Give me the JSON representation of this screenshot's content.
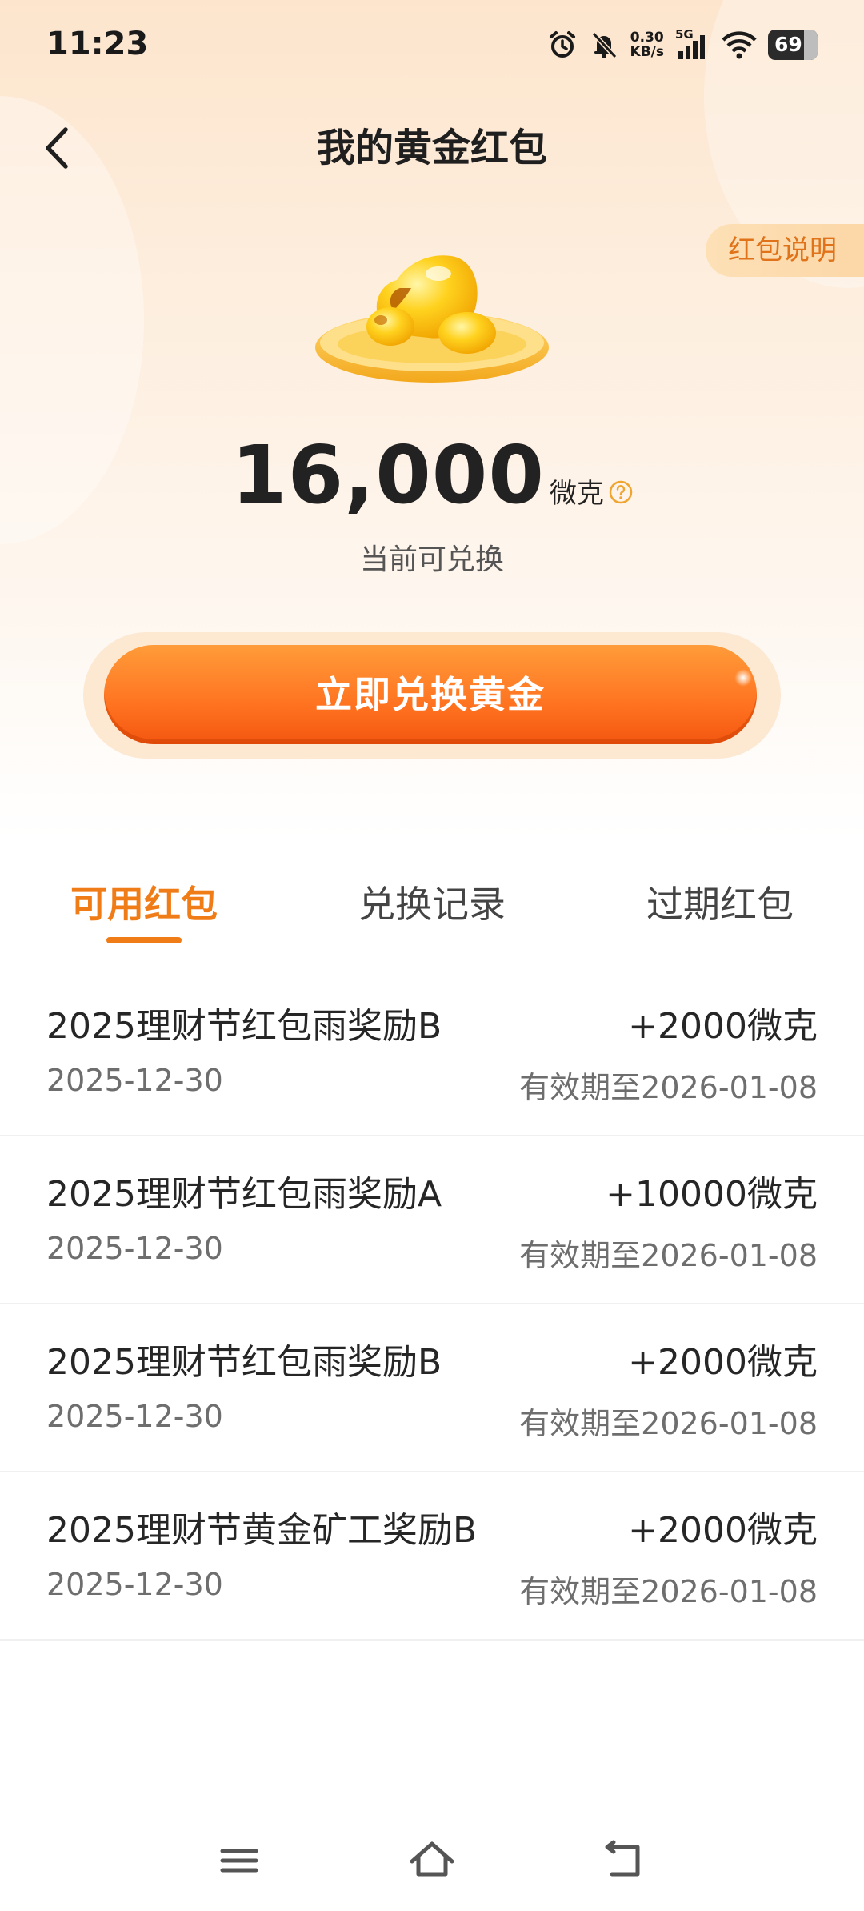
{
  "status_bar": {
    "time": "11:23",
    "net_speed_value": "0.30",
    "net_speed_unit": "KB/s",
    "network_type": "5G",
    "battery": "69"
  },
  "header": {
    "title": "我的黄金红包",
    "explain_label": "红包说明"
  },
  "balance": {
    "value": "16,000",
    "unit": "微克",
    "caption": "当前可兑换"
  },
  "cta": {
    "label": "立即兑换黄金"
  },
  "tabs": [
    {
      "label": "可用红包",
      "active": true
    },
    {
      "label": "兑换记录",
      "active": false
    },
    {
      "label": "过期红包",
      "active": false
    }
  ],
  "records": [
    {
      "name": "2025理财节红包雨奖励B",
      "amount": "+2000微克",
      "date": "2025-12-30",
      "expiry": "有效期至2026-01-08"
    },
    {
      "name": "2025理财节红包雨奖励A",
      "amount": "+10000微克",
      "date": "2025-12-30",
      "expiry": "有效期至2026-01-08"
    },
    {
      "name": "2025理财节红包雨奖励B",
      "amount": "+2000微克",
      "date": "2025-12-30",
      "expiry": "有效期至2026-01-08"
    },
    {
      "name": "2025理财节黄金矿工奖励B",
      "amount": "+2000微克",
      "date": "2025-12-30",
      "expiry": "有效期至2026-01-08"
    }
  ],
  "colors": {
    "accent": "#f07c18",
    "cta_gradient_top": "#ff9c3a",
    "cta_gradient_bottom": "#f35610",
    "hero_bg": "#fde5cd"
  }
}
